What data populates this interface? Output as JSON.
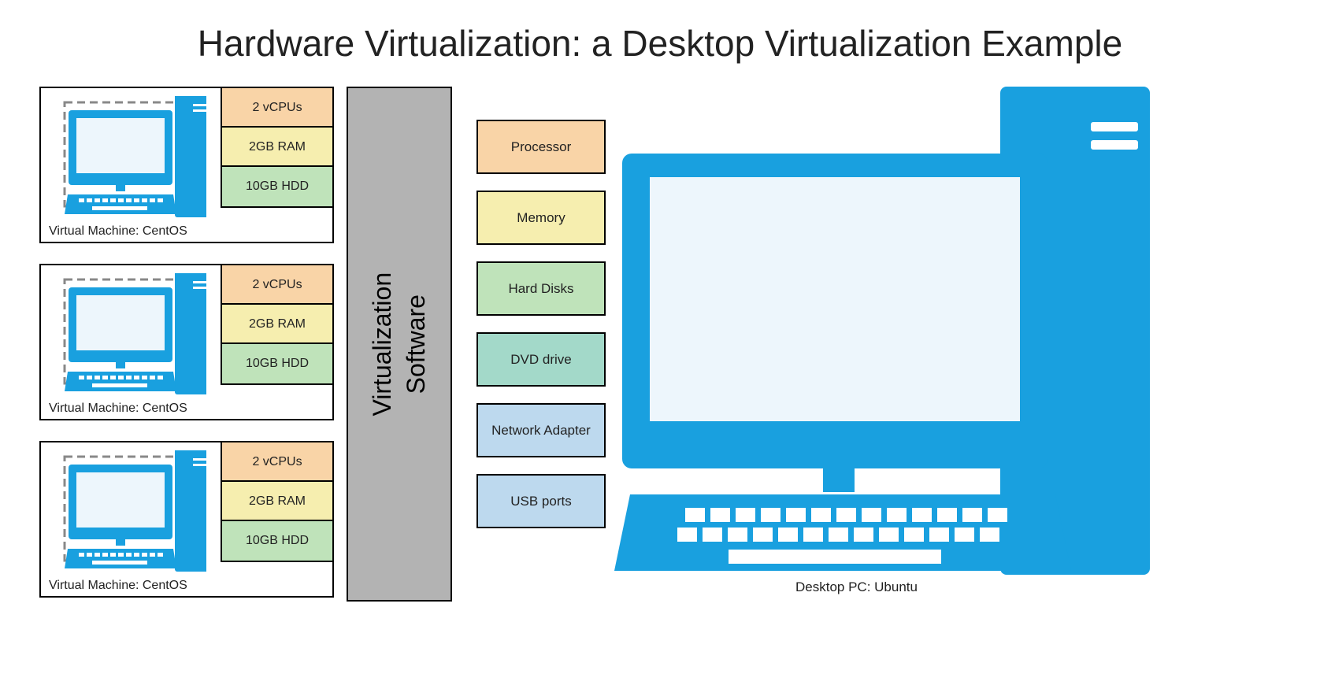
{
  "title": "Hardware Virtualization: a Desktop Virtualization Example",
  "vms": [
    {
      "label": "Virtual Machine: CentOS",
      "specs": {
        "cpu": "2 vCPUs",
        "ram": "2GB RAM",
        "hdd": "10GB HDD"
      }
    },
    {
      "label": "Virtual Machine: CentOS",
      "specs": {
        "cpu": "2 vCPUs",
        "ram": "2GB RAM",
        "hdd": "10GB HDD"
      }
    },
    {
      "label": "Virtual Machine: CentOS",
      "specs": {
        "cpu": "2 vCPUs",
        "ram": "2GB RAM",
        "hdd": "10GB HDD"
      }
    }
  ],
  "virtualization_label": "Virtualization\nSoftware",
  "hardware": [
    {
      "name": "Processor",
      "color": "orange"
    },
    {
      "name": "Memory",
      "color": "yellow"
    },
    {
      "name": "Hard Disks",
      "color": "green"
    },
    {
      "name": "DVD drive",
      "color": "teal"
    },
    {
      "name": "Network Adapter",
      "color": "blue"
    },
    {
      "name": "USB ports",
      "color": "blue"
    }
  ],
  "desktop_label": "Desktop PC: Ubuntu"
}
